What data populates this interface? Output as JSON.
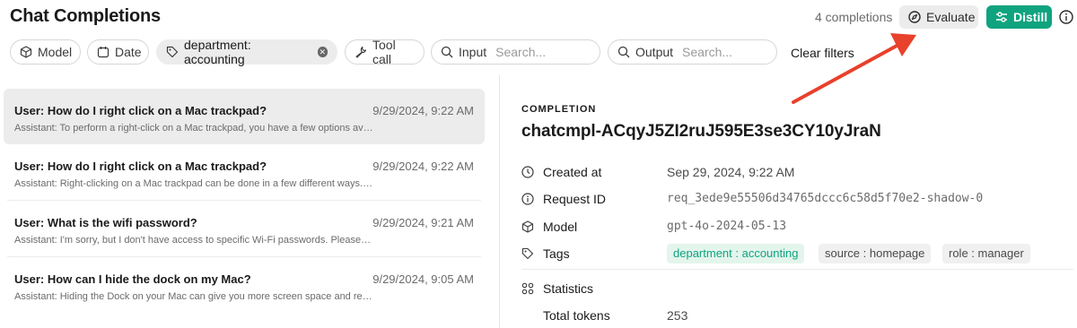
{
  "header": {
    "title": "Chat Completions",
    "count": "4 completions",
    "evaluate_label": "Evaluate",
    "distill_label": "Distill"
  },
  "filters": {
    "model": "Model",
    "date": "Date",
    "department": "department: accounting",
    "tool_call": "Tool call",
    "input_label": "Input",
    "input_placeholder": "Search...",
    "output_label": "Output",
    "output_placeholder": "Search...",
    "clear": "Clear filters"
  },
  "list": [
    {
      "question": "User: How do I right click on a Mac trackpad?",
      "time": "9/29/2024, 9:22 AM",
      "answer": "Assistant: To perform a right-click on a Mac trackpad, you have a few options available...",
      "selected": true
    },
    {
      "question": "User: How do I right click on a Mac trackpad?",
      "time": "9/29/2024, 9:22 AM",
      "answer": "Assistant: Right-clicking on a Mac trackpad can be done in a few different ways. Here...",
      "selected": false
    },
    {
      "question": "User: What is the wifi password?",
      "time": "9/29/2024, 9:21 AM",
      "answer": "Assistant: I'm sorry, but I don't have access to specific Wi-Fi passwords. Please check...",
      "selected": false
    },
    {
      "question": "User: How can I hide the dock on my Mac?",
      "time": "9/29/2024, 9:05 AM",
      "answer": "Assistant: Hiding the Dock on your Mac can give you more screen space and reduce ...",
      "selected": false
    }
  ],
  "detail": {
    "section_label": "COMPLETION",
    "id": "chatcmpl-ACqyJ5ZI2ruJ595E3se3CY10yJraN",
    "created_label": "Created at",
    "created_value": "Sep 29, 2024, 9:22 AM",
    "request_label": "Request ID",
    "request_value": "req_3ede9e55506d34765dccc6c58d5f70e2-shadow-0",
    "model_label": "Model",
    "model_value": "gpt-4o-2024-05-13",
    "tags_label": "Tags",
    "tags": [
      "department : accounting",
      "source : homepage",
      "role : manager"
    ],
    "statistics_label": "Statistics",
    "total_tokens_label": "Total tokens",
    "total_tokens_value": "253"
  },
  "colors": {
    "accent": "#10a37f",
    "annotation_arrow": "#e8412c"
  }
}
